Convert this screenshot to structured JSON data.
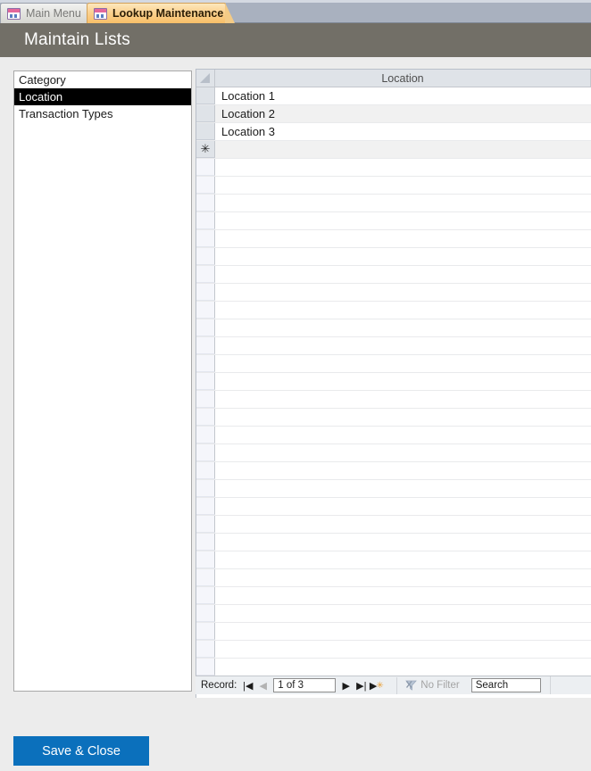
{
  "window": {
    "tabs": [
      {
        "label": "Main Menu",
        "icon": "form-icon",
        "active": false
      },
      {
        "label": "Lookup Maintenance",
        "icon": "form-icon",
        "active": true
      }
    ]
  },
  "header": {
    "title": "Maintain Lists"
  },
  "category_list": {
    "items": [
      {
        "label": "Category",
        "selected": false
      },
      {
        "label": "Location",
        "selected": true
      },
      {
        "label": "Transaction Types",
        "selected": false
      }
    ]
  },
  "datasheet": {
    "column_header": "Location",
    "select_all_corner": "select-all-corner",
    "rows": [
      {
        "value": "Location 1",
        "selector": ""
      },
      {
        "value": "Location 2",
        "selector": ""
      },
      {
        "value": "Location 3",
        "selector": ""
      }
    ],
    "new_row_marker": "✳",
    "empty_row_count": 30
  },
  "navigation": {
    "record_label": "Record:",
    "first_icon": "|◀",
    "prev_icon": "◀",
    "position": "1 of 3",
    "next_icon": "▶",
    "last_icon": "▶|",
    "new_icon": "▶",
    "new_star": "✳",
    "filter_label": "No Filter",
    "filter_icon": "filter-off-icon",
    "search_value": "Search"
  },
  "footer": {
    "save_close_label": "Save & Close"
  },
  "colors": {
    "accent_blue": "#0b70bc",
    "header_gray": "#726f67",
    "tab_active": "#f8bf68",
    "tab_bar": "#a9b1bf",
    "selection_black": "#000000"
  }
}
